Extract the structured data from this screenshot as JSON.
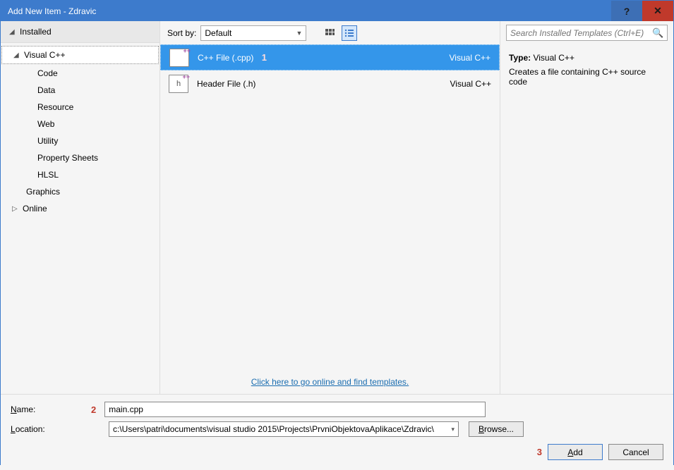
{
  "titlebar": {
    "title": "Add New Item - Zdravic",
    "help": "?",
    "close": "✕"
  },
  "sidebar": {
    "installed": "Installed",
    "visualcpp": "Visual C++",
    "items": [
      "Code",
      "Data",
      "Resource",
      "Web",
      "Utility",
      "Property Sheets",
      "HLSL"
    ],
    "graphics": "Graphics",
    "online": "Online"
  },
  "sort": {
    "label": "Sort by:",
    "value": "Default"
  },
  "templates": [
    {
      "name": "C++ File (.cpp)",
      "lang": "Visual C++",
      "letter": "",
      "annotation": "1",
      "selected": true
    },
    {
      "name": "Header File (.h)",
      "lang": "Visual C++",
      "letter": "h",
      "annotation": "",
      "selected": false
    }
  ],
  "online_link": "Click here to go online and find templates.",
  "search": {
    "placeholder": "Search Installed Templates (Ctrl+E)"
  },
  "preview": {
    "type_label": "Type:",
    "type_value": "Visual C++",
    "description": "Creates a file containing C++ source code"
  },
  "form": {
    "name_label": "Name:",
    "name_value": "main.cpp",
    "name_annotation": "2",
    "location_label": "Location:",
    "location_value": "c:\\Users\\patri\\documents\\visual studio 2015\\Projects\\PrvniObjektovaAplikace\\Zdravic\\",
    "browse": "Browse..."
  },
  "buttons": {
    "add": "Add",
    "cancel": "Cancel",
    "add_annotation": "3"
  }
}
